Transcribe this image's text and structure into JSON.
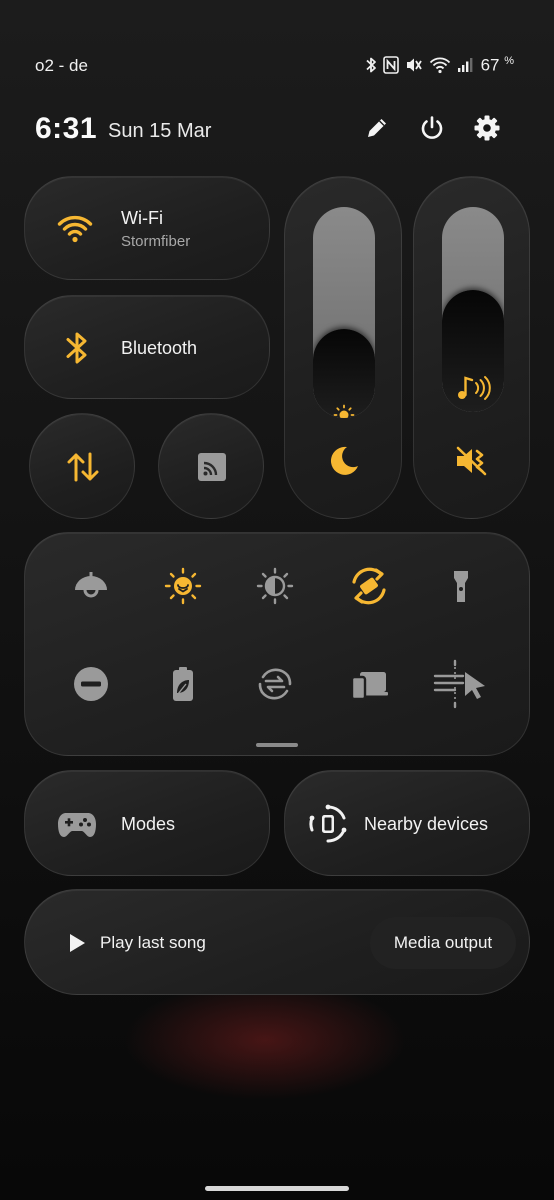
{
  "status": {
    "carrier": "o2 - de",
    "battery_percent": "67",
    "battery_unit": "%",
    "icons": [
      "bluetooth-icon",
      "nfc-icon",
      "mute-icon",
      "wifi-icon",
      "cell-signal-icon"
    ]
  },
  "header": {
    "time": "6:31",
    "date": "Sun 15 Mar",
    "buttons": [
      "edit-icon",
      "power-icon",
      "settings-icon"
    ]
  },
  "tiles": {
    "wifi": {
      "title": "Wi-Fi",
      "subtitle": "Stormfiber",
      "active": true,
      "icon": "wifi-icon"
    },
    "bluetooth": {
      "title": "Bluetooth",
      "active": true,
      "icon": "bluetooth-icon"
    },
    "mobile_data": {
      "icon": "mobile-data-icon",
      "active": true
    },
    "cast": {
      "icon": "cast-icon",
      "active": false
    },
    "modes": {
      "title": "Modes",
      "icon": "gamepad-icon"
    },
    "nearby": {
      "title": "Nearby devices",
      "icon": "nearby-devices-icon"
    }
  },
  "sliders": {
    "brightness": {
      "level": 0.35,
      "icon": "brightness-icon",
      "toggle_icon": "dark-mode-moon-icon"
    },
    "volume": {
      "level": 0.48,
      "icon": "volume-icon",
      "toggle_icon": "vibrate-mute-icon"
    }
  },
  "quick_toggles": [
    {
      "icon": "lamp-icon",
      "active": false
    },
    {
      "icon": "eye-comfort-icon",
      "active": true
    },
    {
      "icon": "extra-dim-icon",
      "active": false
    },
    {
      "icon": "auto-rotate-icon",
      "active": true
    },
    {
      "icon": "flashlight-icon",
      "active": false
    },
    {
      "icon": "do-not-disturb-icon",
      "active": false
    },
    {
      "icon": "power-saving-icon",
      "active": false
    },
    {
      "icon": "data-saver-icon",
      "active": false
    },
    {
      "icon": "link-to-windows-icon",
      "active": false
    },
    {
      "icon": "quick-share-icon",
      "active": false
    }
  ],
  "media": {
    "play_label": "Play last song",
    "output_label": "Media output"
  },
  "colors": {
    "accent": "#f6b732",
    "inactive_icon": "#9a9a9a",
    "tile_bg": "#232323"
  }
}
